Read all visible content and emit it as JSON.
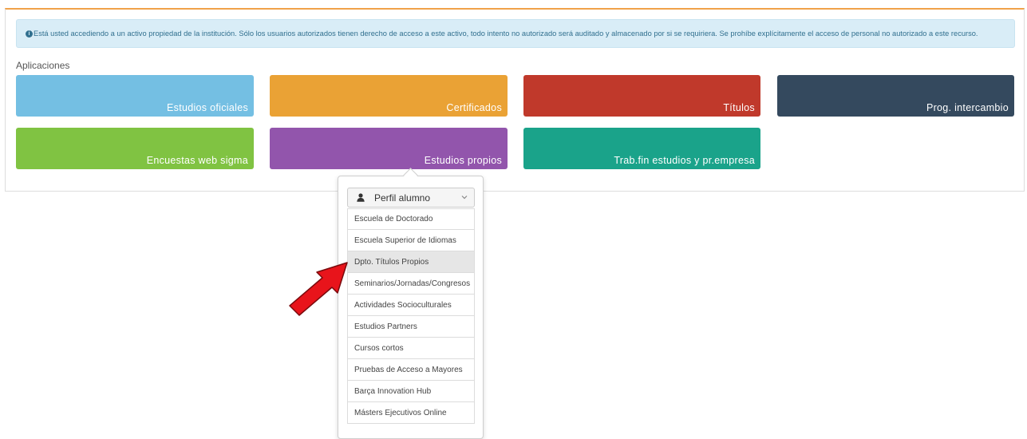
{
  "alert": {
    "icon": "info-circle-icon",
    "text": "Está usted accediendo a un activo propiedad de la institución. Sólo los usuarios autorizados tienen derecho de acceso a este activo, todo intento no autorizado será auditado y almacenado por si se requiriera. Se prohíbe explícitamente el acceso de personal no autorizado a este recurso."
  },
  "section_title": "Aplicaciones",
  "tiles": [
    {
      "label": "Estudios oficiales",
      "color": "#74bfe3"
    },
    {
      "label": "Certificados",
      "color": "#eaa235"
    },
    {
      "label": "Títulos",
      "color": "#c0392b"
    },
    {
      "label": "Prog. intercambio",
      "color": "#34495e"
    },
    {
      "label": "Encuestas web sigma",
      "color": "#80c342"
    },
    {
      "label": "Estudios propios",
      "color": "#9255ac"
    },
    {
      "label": "Trab.fin estudios y pr.empresa",
      "color": "#1aa38a"
    }
  ],
  "dropdown": {
    "profile_label": "Perfil alumno",
    "profile_icon": "user-icon",
    "items": [
      "Escuela de Doctorado",
      "Escuela Superior de Idiomas",
      "Dpto. Títulos Propios",
      "Seminarios/Jornadas/Congresos",
      "Actividades Socioculturales",
      "Estudios Partners",
      "Cursos cortos",
      "Pruebas de Acceso a Mayores",
      "Barça Innovation Hub",
      "Másters Ejecutivos Online"
    ],
    "active_item": "Dpto. Títulos Propios"
  },
  "annotation": {
    "icon": "red-arrow-icon",
    "color": "#e8141b"
  }
}
